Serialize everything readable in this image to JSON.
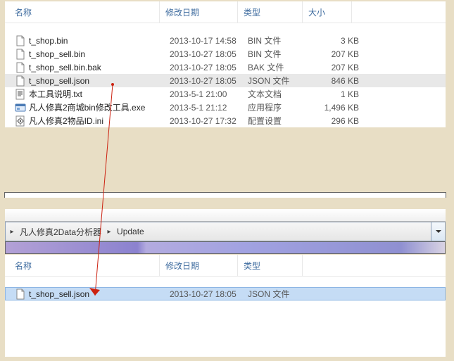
{
  "columns": {
    "name": "名称",
    "date": "修改日期",
    "type": "类型",
    "size": "大小"
  },
  "top_files": [
    {
      "icon": "file-icon",
      "name": "t_shop.bin",
      "date": "2013-10-17 14:58",
      "type": "BIN 文件",
      "size": "3 KB",
      "selected": false
    },
    {
      "icon": "file-icon",
      "name": "t_shop_sell.bin",
      "date": "2013-10-27 18:05",
      "type": "BIN 文件",
      "size": "207 KB",
      "selected": false
    },
    {
      "icon": "file-icon",
      "name": "t_shop_sell.bin.bak",
      "date": "2013-10-27 18:05",
      "type": "BAK 文件",
      "size": "207 KB",
      "selected": false
    },
    {
      "icon": "file-icon",
      "name": "t_shop_sell.json",
      "date": "2013-10-27 18:05",
      "type": "JSON 文件",
      "size": "846 KB",
      "selected": true
    },
    {
      "icon": "txt-icon",
      "name": "本工具说明.txt",
      "date": "2013-5-1 21:00",
      "type": "文本文档",
      "size": "1 KB",
      "selected": false
    },
    {
      "icon": "exe-icon",
      "name": "凡人修真2商城bin修改工具.exe",
      "date": "2013-5-1 21:12",
      "type": "应用程序",
      "size": "1,496 KB",
      "selected": false
    },
    {
      "icon": "ini-icon",
      "name": "凡人修真2物品ID.ini",
      "date": "2013-10-27 17:32",
      "type": "配置设置",
      "size": "296 KB",
      "selected": false
    }
  ],
  "breadcrumb": {
    "seg1": "凡人修真2Data分析器",
    "seg2": "Update",
    "chev": "▸"
  },
  "bottom_files": [
    {
      "icon": "file-icon",
      "name": "t_shop_sell.json",
      "date": "2013-10-27 18:05",
      "type": "JSON 文件",
      "size": "",
      "selected": true
    }
  ]
}
